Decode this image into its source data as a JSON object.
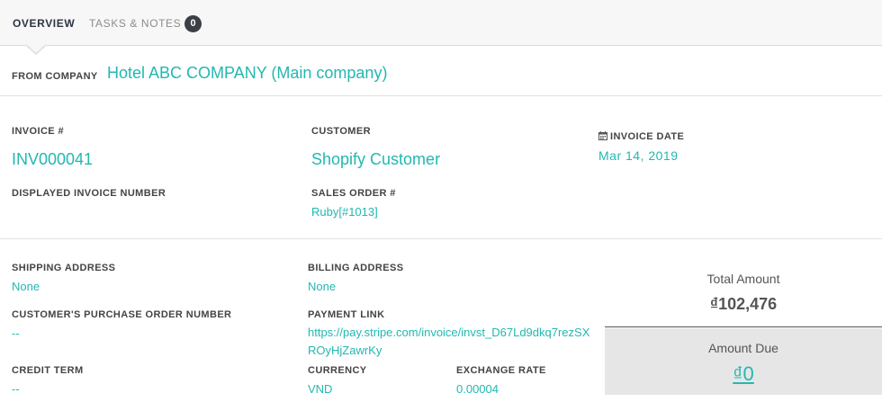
{
  "tabs": {
    "overview": "OVERVIEW",
    "tasks_notes": "TASKS & NOTES",
    "tasks_count": "0"
  },
  "from_company": {
    "label": "FROM COMPANY",
    "value": "Hotel ABC COMPANY (Main company)"
  },
  "invoice": {
    "number_label": "INVOICE #",
    "number_value": "INV000041",
    "displayed_label": "DISPLAYED INVOICE NUMBER",
    "customer_label": "CUSTOMER",
    "customer_value": "Shopify Customer",
    "sales_order_label": "SALES ORDER #",
    "sales_order_value": "Ruby[#1013]",
    "date_label": "INVOICE DATE",
    "date_value": "Mar 14, 2019",
    "date_icon": "calendar-icon"
  },
  "details": {
    "shipping_label": "SHIPPING ADDRESS",
    "shipping_value": "None",
    "billing_label": "BILLING ADDRESS",
    "billing_value": "None",
    "po_label": "CUSTOMER'S PURCHASE ORDER NUMBER",
    "po_value": "--",
    "payment_link_label": "PAYMENT LINK",
    "payment_link_value": "https://pay.stripe.com/invoice/invst_D67Ld9dkq7rezSXROyHjZawrKy",
    "credit_term_label": "CREDIT TERM",
    "credit_term_value": "--",
    "currency_label": "CURRENCY",
    "currency_value": "VND",
    "exchange_rate_label": "EXCHANGE RATE",
    "exchange_rate_value": "0.00004"
  },
  "totals": {
    "total_label": "Total Amount",
    "total_value": "₫102,476",
    "due_label": "Amount Due",
    "due_value": "₫0"
  },
  "colors": {
    "accent": "#22b8b0",
    "tab_active": "#2c3444",
    "badge_bg": "#3b3f46",
    "due_bg": "#e6e6e6"
  }
}
